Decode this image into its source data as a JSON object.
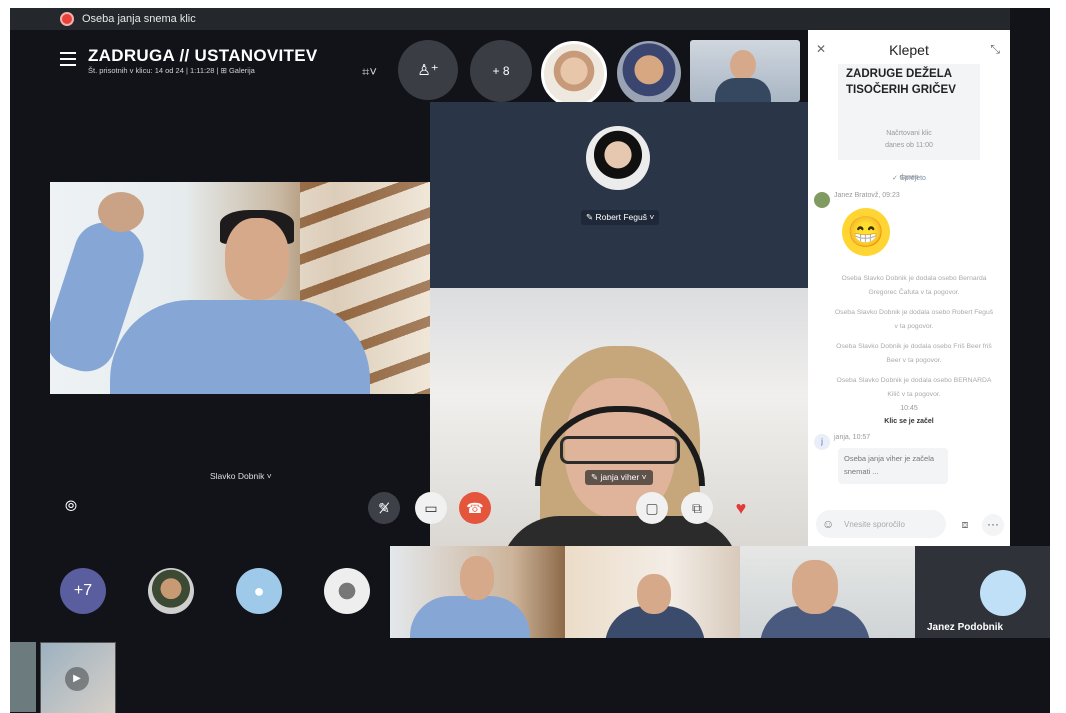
{
  "recording_bar": {
    "text": "Oseba janja snema klic"
  },
  "header": {
    "title": "ZADRUGA // USTANOVITEV",
    "subtitle": "Št. prisotnih v klicu: 14 od 24 | 1:11:28 | ⊞ Galerija",
    "more_participants": "+ 8"
  },
  "participants": {
    "main_left": "Slavko Dobnik",
    "robert": "Robert Feguš",
    "janja": "janja viher",
    "bottom_plus": "+7",
    "bottom_last": "Janez Podobnik"
  },
  "chat": {
    "title": "Klepet",
    "card_title": "ZADRUGE DEŽELA TISOČERIH GRIČEV",
    "card_sub1": "Načrtovani klic",
    "card_sub2": "danes ob 11:00",
    "card_accept": "✓ Sprejeto",
    "date_label": "danes",
    "author1": "Janez Bratovž, 09:23",
    "sys1": "Oseba Slavko Dobnik je dodala osebo Bernarda Gregorec Čafuta v ta pogovor.",
    "sys2": "Oseba Slavko Dobnik je dodala osebo Robert Feguš v ta pogovor.",
    "sys3": "Oseba Slavko Dobnik je dodala osebo Friš Beer friš Beer v ta pogovor.",
    "sys4": "Oseba Slavko Dobnik je dodala osebo BERNARDA Kilič v ta pogovor.",
    "time2": "10:45",
    "call_started": "Klic se je začel",
    "author2": "janja, 10:57",
    "bubble": "Oseba janja viher je začela snemati ...",
    "input_placeholder": "Vnesite sporočilo"
  },
  "icons": {
    "menu": "menu-icon",
    "add_people": "add-person-icon",
    "mic": "mic-off-icon",
    "video": "video-icon",
    "hangup": "hangup-icon",
    "chat": "chat-icon",
    "share": "share-screen-icon",
    "react": "heart-icon",
    "more": "more-icon"
  },
  "colors": {
    "hangup": "#e4553c",
    "recording": "#e6413a",
    "plus_avatar": "#5b5e9e"
  }
}
